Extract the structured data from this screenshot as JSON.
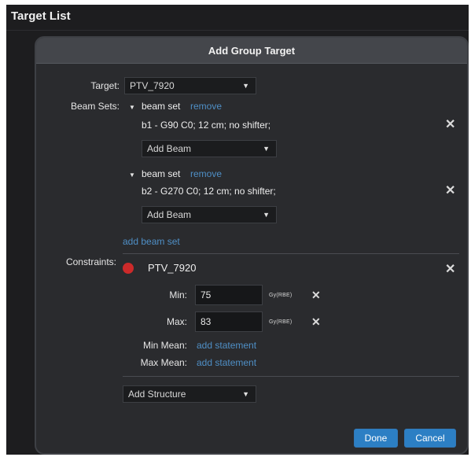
{
  "window": {
    "title": "Target List"
  },
  "dialog": {
    "title": "Add Group Target",
    "target_label": "Target:",
    "target_value": "PTV_7920",
    "beam_sets_label": "Beam Sets:",
    "beam_sets": [
      {
        "label": "beam set",
        "remove": "remove",
        "beam": "b1 - G90 C0; 12 cm; no shifter;",
        "add_beam": "Add Beam"
      },
      {
        "label": "beam set",
        "remove": "remove",
        "beam": "b2 - G270 C0; 12 cm; no shifter;",
        "add_beam": "Add Beam"
      }
    ],
    "add_beam_set": "add beam set",
    "constraints_label": "Constraints:",
    "constraint": {
      "structure": "PTV_7920",
      "color": "#cc2a2a",
      "min_label": "Min:",
      "min_value": "75",
      "min_unit": "Gy(RBE)",
      "max_label": "Max:",
      "max_value": "83",
      "max_unit": "Gy(RBE)",
      "min_mean_label": "Min Mean:",
      "max_mean_label": "Max Mean:",
      "add_statement": "add statement"
    },
    "add_structure": "Add Structure",
    "done": "Done",
    "cancel": "Cancel"
  },
  "colors": {
    "button": "#2c7fc4",
    "link": "#4f8fc6",
    "accent_red": "#cc2a2a"
  }
}
